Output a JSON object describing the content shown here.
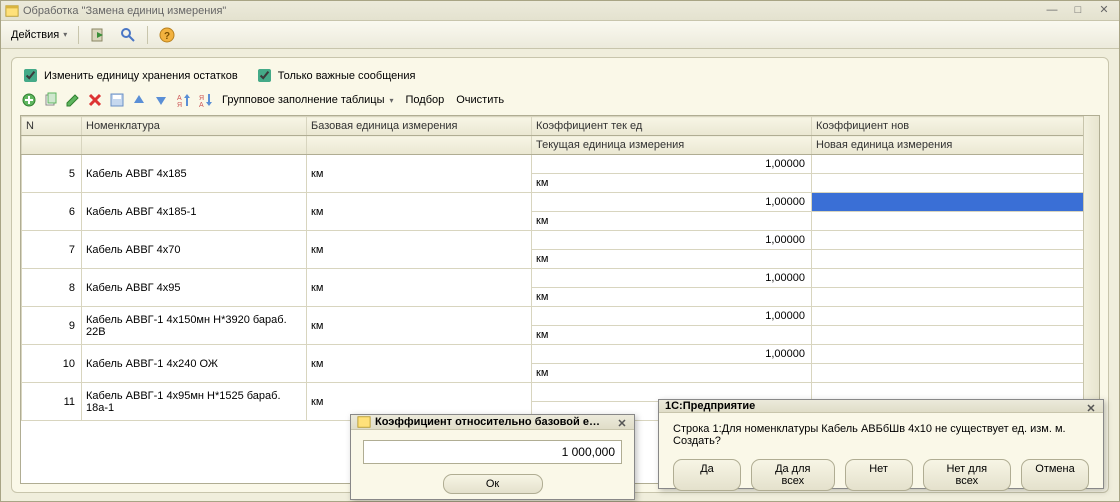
{
  "window": {
    "title": "Обработка  \"Замена единиц измерения\""
  },
  "menu": {
    "actions": "Действия",
    "help_tooltip": "Справка"
  },
  "checks": {
    "change_storage_unit": "Изменить единицу хранения остатков",
    "only_important": "Только важные сообщения"
  },
  "toolbar": {
    "group_fill": "Групповое заполнение таблицы",
    "select": "Подбор",
    "clear": "Очистить"
  },
  "table": {
    "headers": {
      "n": "N",
      "nomen": "Номенклатура",
      "base": "Базовая единица измерения",
      "coef_cur": "Коэффициент тек ед",
      "coef_new": "Коэффициент нов"
    },
    "subheaders": {
      "cur_unit": "Текущая единица измерения",
      "new_unit": "Новая единица измерения"
    },
    "rows": [
      {
        "n": "5",
        "nomen": "Кабель АВВГ 4x185",
        "base": "км",
        "coef": "1,00000",
        "cur": "км",
        "new": ""
      },
      {
        "n": "6",
        "nomen": "Кабель АВВГ 4x185-1",
        "base": "км",
        "coef": "1,00000",
        "cur": "км",
        "new": "",
        "highlight_new": true
      },
      {
        "n": "7",
        "nomen": "Кабель АВВГ 4x70",
        "base": "км",
        "coef": "1,00000",
        "cur": "км",
        "new": ""
      },
      {
        "n": "8",
        "nomen": "Кабель АВВГ 4x95",
        "base": "км",
        "coef": "1,00000",
        "cur": "км",
        "new": ""
      },
      {
        "n": "9",
        "nomen": "Кабель АВВГ-1 4x150мн Н*3920 бараб. 22В",
        "base": "км",
        "coef": "1,00000",
        "cur": "км",
        "new": ""
      },
      {
        "n": "10",
        "nomen": "Кабель АВВГ-1 4x240 ОЖ",
        "base": "км",
        "coef": "1,00000",
        "cur": "км",
        "new": ""
      },
      {
        "n": "11",
        "nomen": "Кабель АВВГ-1 4x95мн Н*1525 бараб. 18а-1",
        "base": "км",
        "coef": "",
        "cur": "",
        "new": ""
      }
    ]
  },
  "dialog_coef": {
    "title": "Коэффициент относительно базовой е…",
    "value": "1 000,000",
    "ok": "Ок"
  },
  "dialog_confirm": {
    "title": "1С:Предприятие",
    "text": "Строка 1:Для номенклатуры Кабель АВБбШв 4x10 не существует ед. изм. м. Создать?",
    "yes": "Да",
    "yes_all": "Да для всех",
    "no": "Нет",
    "no_all": "Нет для всех",
    "cancel": "Отмена"
  }
}
